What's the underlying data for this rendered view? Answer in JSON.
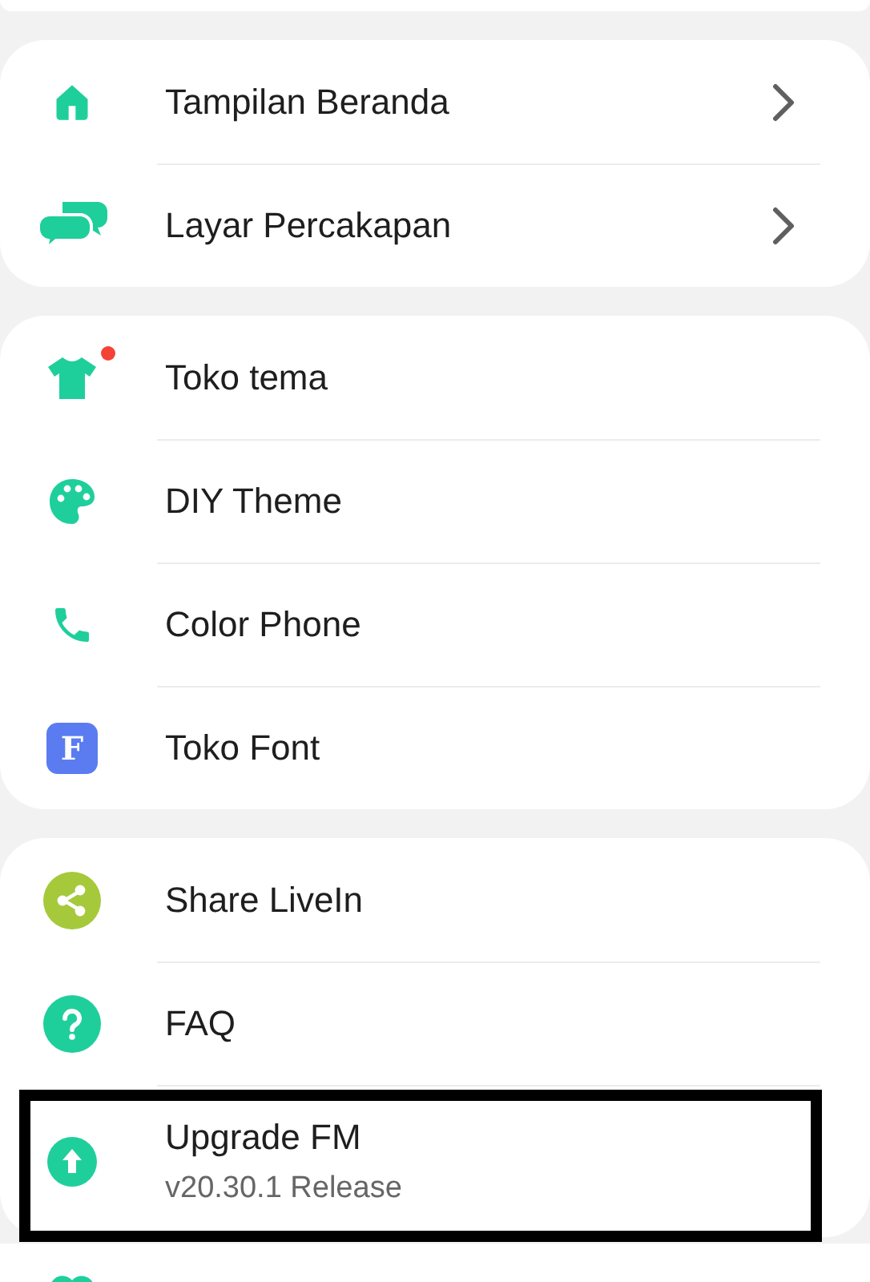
{
  "sections": [
    {
      "items": [
        {
          "kind": "home",
          "label": "Tampilan Beranda",
          "chevron": true,
          "badge_dot": false,
          "highlighted": false
        },
        {
          "kind": "chat",
          "label": "Layar Percakapan",
          "chevron": true,
          "badge_dot": false,
          "highlighted": false
        }
      ]
    },
    {
      "items": [
        {
          "kind": "shirt",
          "label": "Toko tema",
          "chevron": false,
          "badge_dot": true,
          "highlighted": false
        },
        {
          "kind": "palette",
          "label": "DIY Theme",
          "chevron": false,
          "badge_dot": false,
          "highlighted": false
        },
        {
          "kind": "phone",
          "label": "Color Phone",
          "chevron": false,
          "badge_dot": false,
          "highlighted": false
        },
        {
          "kind": "letter",
          "icon_letter": "F",
          "label": "Toko Font",
          "chevron": false,
          "badge_dot": false,
          "highlighted": false
        }
      ]
    },
    {
      "items": [
        {
          "kind": "share",
          "label": "Share LiveIn",
          "chevron": false,
          "badge_dot": false,
          "highlighted": false
        },
        {
          "kind": "help",
          "label": "FAQ",
          "chevron": false,
          "badge_dot": false,
          "highlighted": false
        },
        {
          "kind": "upgrade",
          "label": "Upgrade FM",
          "subtitle": "v20.30.1 Release",
          "chevron": false,
          "badge_dot": false,
          "highlighted": true
        }
      ]
    }
  ]
}
